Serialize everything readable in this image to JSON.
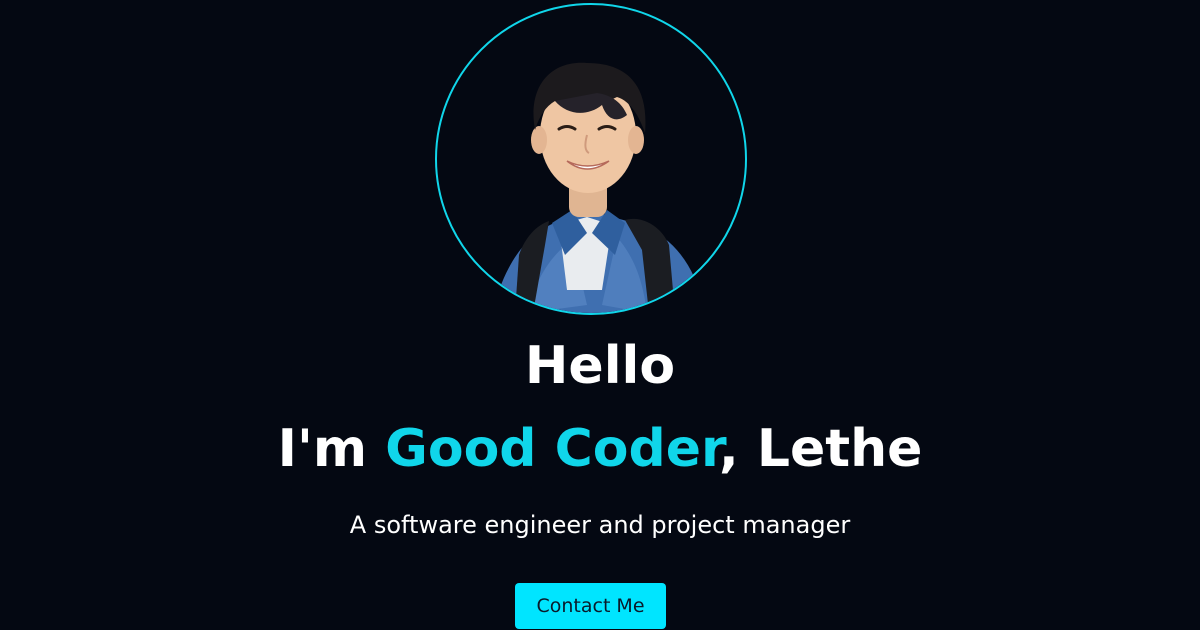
{
  "hero": {
    "greeting": "Hello",
    "intro_prefix": "I'm ",
    "intro_highlight": "Good Coder",
    "intro_suffix": ", Lethe",
    "tagline": "A software engineer and project manager",
    "cta_label": "Contact Me"
  },
  "colors": {
    "background": "#040812",
    "accent": "#10d6ea",
    "button": "#00e5ff",
    "text": "#ffffff"
  }
}
